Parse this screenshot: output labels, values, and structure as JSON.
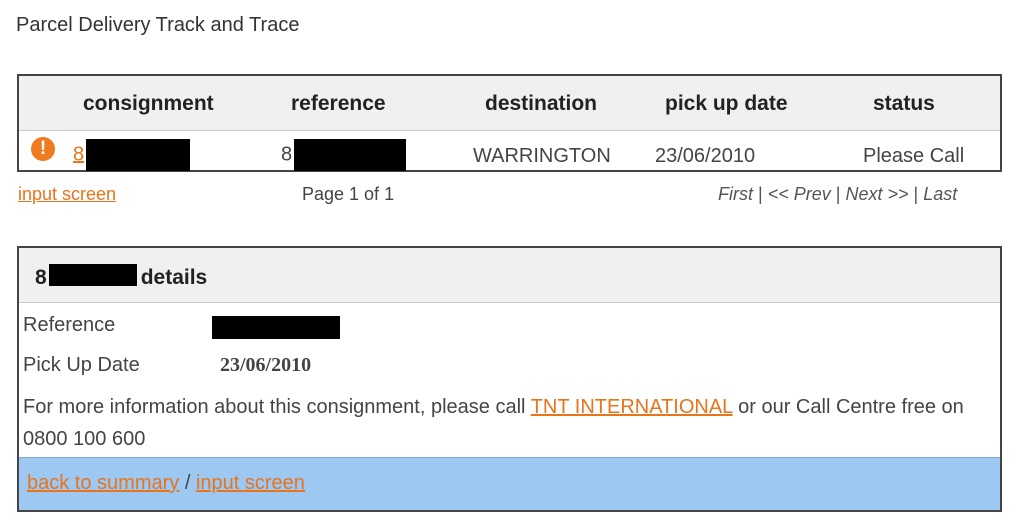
{
  "page": {
    "title": "Parcel Delivery Track and Trace"
  },
  "results": {
    "columns": [
      "consignment",
      "reference",
      "destination",
      "pick up date",
      "status"
    ],
    "row": {
      "icon": "warning-icon",
      "consignment_prefix": "8",
      "reference_prefix": "8",
      "destination": "WARRINGTON",
      "pick_up_date": "23/06/2010",
      "status": "Please Call"
    }
  },
  "pager": {
    "input_screen": "input screen",
    "page_info": "Page 1 of 1",
    "first": "First",
    "prev": "<< Prev",
    "next": "Next >>",
    "last": "Last",
    "separator": "|"
  },
  "details": {
    "title_prefix": "8",
    "title_suffix": "details",
    "reference_label": "Reference",
    "pickup_label": "Pick Up Date",
    "pickup_value": "23/06/2010",
    "info_text_1": "For more information about this consignment, please call",
    "info_link": "TNT INTERNATIONAL",
    "info_text_2": "or our Call Centre free on",
    "phone": "0800 100 600",
    "back_link": "back to summary",
    "slash": "/",
    "input_link": "input screen"
  },
  "colors": {
    "accent_link": "#e8741c",
    "footer_bg": "#9cc8f2",
    "warning": "#f07b1f"
  }
}
